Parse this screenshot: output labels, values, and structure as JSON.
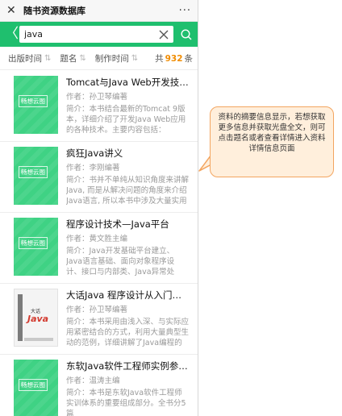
{
  "titlebar": {
    "title": "随书资源数据库",
    "close_glyph": "✕",
    "more_glyph": "···"
  },
  "searchbar": {
    "back_glyph": "〈",
    "query": "java"
  },
  "sortbar": {
    "options": [
      {
        "label": "出版时间"
      },
      {
        "label": "题名"
      },
      {
        "label": "制作时间"
      }
    ],
    "total_prefix": "共",
    "total_count": "932",
    "total_suffix": "条"
  },
  "books": [
    {
      "title": "Tomcat与Java Web开发技术详解",
      "author": "作者：孙卫琴编著",
      "intro": "简介：本书结合最新的Tomcat 9版本，详细介绍了开发Java Web应用的各种技术。主要内容包括：Tomcat和Java Web开发的基础知识",
      "cover_label": "畅想云图",
      "cover_type": "green"
    },
    {
      "title": "疯狂Java讲义",
      "author": "作者：李刚编著",
      "intro": "简介：书并不单纯从知识角度来讲解Java, 而是从解决问题的角度来介绍Java语言, 所以本书中涉及大量实用案例",
      "cover_label": "畅想云图",
      "cover_type": "green"
    },
    {
      "title": "程序设计技术—Java平台",
      "author": "作者：黄文胜主编",
      "intro": "简介：Java开发基础平台建立、Java语言基础、面向对象程序设计、接口与内部类、Java异常处理、流与文件",
      "cover_label": "畅想云图",
      "cover_type": "green"
    },
    {
      "title": "大话Java 程序设计从入门到精通",
      "author": "作者：孙卫琴编著",
      "intro": "简介：本书采用由浅入深、与实际应用紧密结合的方式，利用大量典型生动的范例，详细讲解了Java编程的基础知识",
      "cover_label": "",
      "cover_type": "photo",
      "cover_text_small": "大话",
      "cover_text_big": "Java"
    },
    {
      "title": "东软Java软件工程师实例参考书",
      "author": "作者：温涛主编",
      "intro": "简介：本书是东软Java软件工程师实训体系的重要组成部分。全书分5篇",
      "cover_label": "畅想云图",
      "cover_type": "green"
    }
  ],
  "callout": {
    "text": "资料的摘要信息显示，若想获取更多信息并获取光盘全文，则可点击题名或者查看详情进入资料详情信息页面"
  },
  "colors": {
    "accent": "#1fbf6e",
    "count": "#f08c00",
    "callout_border": "#f3a560",
    "callout_bg": "#ffefdc"
  },
  "icons": [
    "close-icon",
    "more-icon",
    "back-icon",
    "clear-icon",
    "search-icon",
    "sort-icon"
  ]
}
